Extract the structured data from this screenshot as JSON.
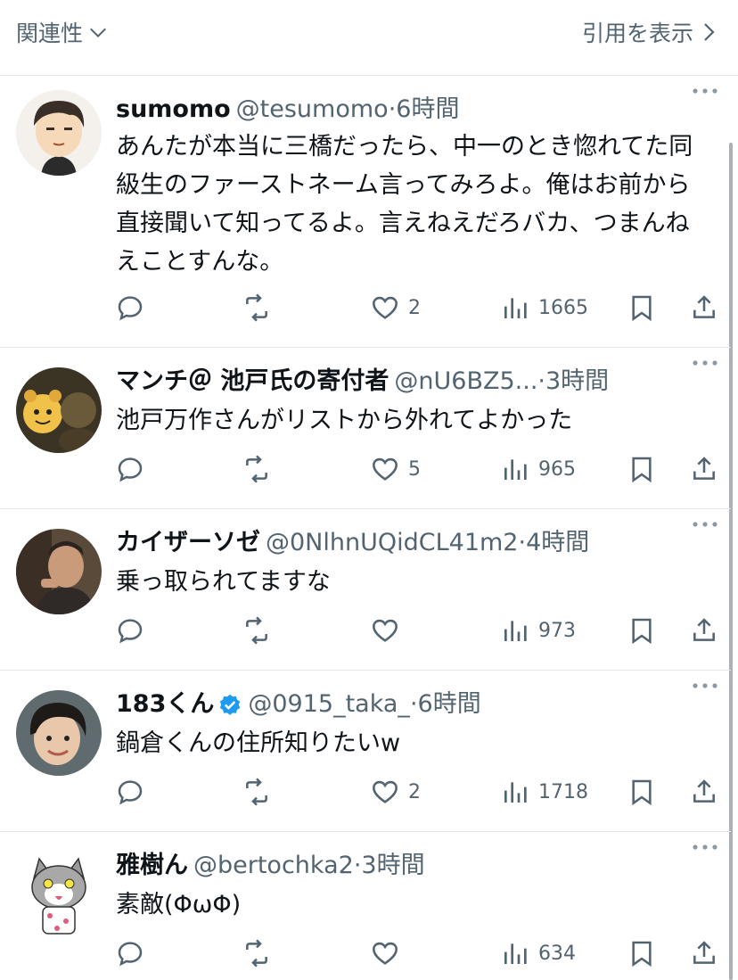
{
  "header": {
    "sort_label": "関連性",
    "quotes_label": "引用を表示"
  },
  "posts": [
    {
      "name": "sumomo",
      "handle": "@tesumomo",
      "sep": "·",
      "time": "6時間",
      "text": "あんたが本当に三橋だったら、中一のとき惚れてた同級生のファーストネーム言ってみろよ。俺はお前から直接聞いて知ってるよ。言えねえだろバカ、つまんねえことすんな。",
      "likes": "2",
      "views": "1665"
    },
    {
      "name": "マンチ＠ 池戸氏の寄付者",
      "handle": "@nU6BZ5...",
      "sep": "·",
      "time": "3時間",
      "text": "池戸万作さんがリストから外れてよかった",
      "likes": "5",
      "views": "965"
    },
    {
      "name": "カイザーソゼ",
      "handle": "@0NlhnUQidCL41m2",
      "sep": "·",
      "time": "4時間",
      "text": "乗っ取られてますな",
      "likes": "",
      "views": "973"
    },
    {
      "name": "183くん",
      "handle": "@0915_taka_",
      "sep": "·",
      "time": "6時間",
      "text": "鍋倉くんの住所知りたいw",
      "likes": "2",
      "views": "1718",
      "verified": true
    },
    {
      "name": "雅樹ん",
      "handle": "@bertochka2",
      "sep": "·",
      "time": "3時間",
      "text": "素敵(ΦωΦ)",
      "likes": "",
      "views": "634"
    }
  ],
  "icons": [
    "chevron-down-icon",
    "chevron-right-icon",
    "more-icon",
    "reply-icon",
    "repost-icon",
    "like-icon",
    "views-icon",
    "bookmark-icon",
    "share-icon",
    "verified-badge-icon"
  ],
  "colors": {
    "text": "#0f1419",
    "secondary": "#536471",
    "verified": "#1d9bf0",
    "divider": "#e3e6e9"
  }
}
